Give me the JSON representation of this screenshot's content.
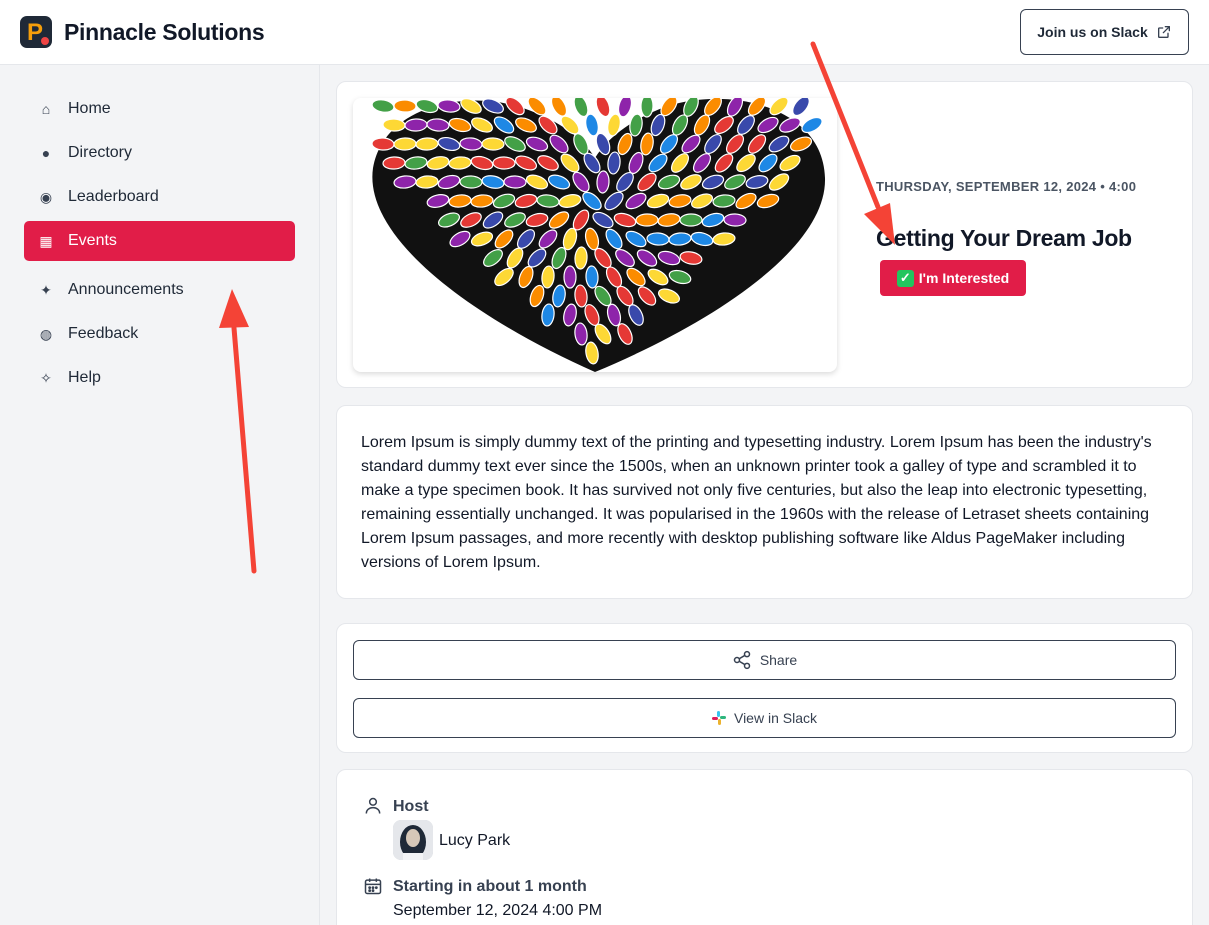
{
  "app": {
    "brand": "Pinnacle Solutions",
    "slack_button": "Join us on Slack"
  },
  "sidebar": {
    "items": [
      {
        "label": "Home",
        "icon": "home-icon"
      },
      {
        "label": "Directory",
        "icon": "people-icon"
      },
      {
        "label": "Leaderboard",
        "icon": "medal-icon"
      },
      {
        "label": "Events",
        "icon": "calendar-icon",
        "active": true
      },
      {
        "label": "Announcements",
        "icon": "satellite-icon"
      },
      {
        "label": "Feedback",
        "icon": "globe-icon"
      },
      {
        "label": "Help",
        "icon": "handshake-icon"
      }
    ]
  },
  "event": {
    "date_line": "THURSDAY, SEPTEMBER 12, 2024 • 4:00",
    "title": "Getting Your Dream Job",
    "interested_label": "I'm Interested",
    "description": "Lorem Ipsum is simply dummy text of the printing and typesetting industry. Lorem Ipsum has been the industry's standard dummy text ever since the 1500s, when an unknown printer took a galley of type and scrambled it to make a type specimen book. It has survived not only five centuries, but also the leap into electronic typesetting, remaining essentially unchanged. It was popularised in the 1960s with the release of Letraset sheets containing Lorem Ipsum passages, and more recently with desktop publishing software like Aldus PageMaker including versions of Lorem Ipsum."
  },
  "actions": {
    "share_label": "Share",
    "slack_label": "View in Slack"
  },
  "details": {
    "host_label": "Host",
    "host_name": "Lucy Park",
    "start_label": "Starting in about 1 month",
    "start_datetime": "September 12, 2024 4:00 PM"
  },
  "colors": {
    "accent": "#e11d48",
    "annotation_arrow": "#f44336"
  }
}
